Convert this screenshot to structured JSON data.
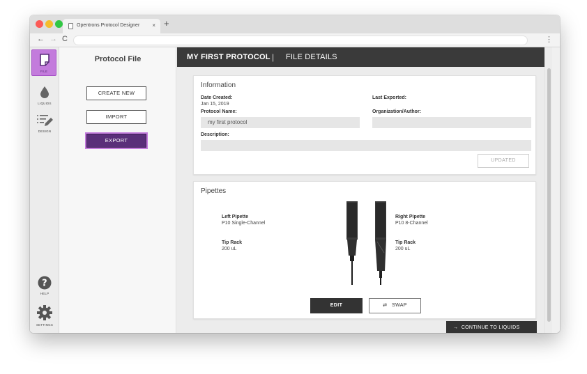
{
  "browser": {
    "tab_title": "Opentrons Protocol Designer",
    "tab_close": "×",
    "new_tab": "+",
    "back": "←",
    "forward": "→",
    "reload": "C",
    "menu": "⋮",
    "traffic_colors": [
      "#fc5b57",
      "#f5bd2c",
      "#31c743"
    ]
  },
  "nav_rail": {
    "items": [
      {
        "label": "FILE",
        "icon": "file-icon",
        "active": true
      },
      {
        "label": "LIQUIDS",
        "icon": "droplet-icon"
      },
      {
        "label": "DESIGN",
        "icon": "design-icon"
      },
      {
        "label": "HELP",
        "icon": "help-icon"
      },
      {
        "label": "SETTINGS",
        "icon": "gear-icon"
      }
    ]
  },
  "sidebar": {
    "title": "Protocol File",
    "create_new": "CREATE NEW",
    "import": "IMPORT",
    "export": "EXPORT"
  },
  "header": {
    "protocol_name": "MY FIRST PROTOCOL",
    "separator": "|",
    "section": "FILE DETAILS"
  },
  "information": {
    "title": "Information",
    "date_created_label": "Date Created:",
    "date_created_value": "Jan 15, 2019",
    "last_exported_label": "Last Exported:",
    "protocol_name_label": "Protocol Name:",
    "protocol_name_value": "my first protocol",
    "organization_label": "Organization/Author:",
    "organization_value": "",
    "description_label": "Description:",
    "description_value": "",
    "updated_button": "UPDATED"
  },
  "pipettes": {
    "title": "Pipettes",
    "left_label": "Left Pipette",
    "left_value": "P10 Single-Channel",
    "left_tiprack_label": "Tip Rack",
    "left_tiprack_value": "200 uL",
    "right_label": "Right Pipette",
    "right_value": "P10 8-Channel",
    "right_tiprack_label": "Tip Rack",
    "right_tiprack_value": "200 uL",
    "edit_button": "EDIT",
    "swap_icon": "⇄",
    "swap_button": "SWAP"
  },
  "footer": {
    "continue_arrow": "→",
    "continue_button": "CONTINUE TO LIQUIDS"
  },
  "colors": {
    "accent": "#c37bdc",
    "primary_dark": "#5a2f79",
    "header_bg": "#3a3a3a"
  }
}
